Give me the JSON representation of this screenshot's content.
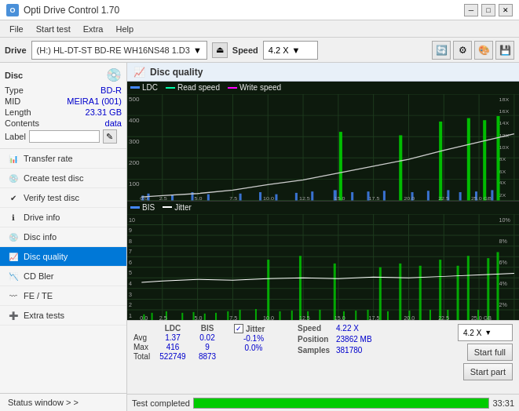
{
  "titlebar": {
    "title": "Opti Drive Control 1.70",
    "icon": "O"
  },
  "menubar": {
    "items": [
      "File",
      "Start test",
      "Extra",
      "Help"
    ]
  },
  "drivebar": {
    "drive_label": "Drive",
    "drive_value": "(H:)  HL-DT-ST BD-RE  WH16NS48 1.D3",
    "speed_label": "Speed",
    "speed_value": "4.2 X"
  },
  "disc": {
    "title": "Disc",
    "type_label": "Type",
    "type_value": "BD-R",
    "mid_label": "MID",
    "mid_value": "MEIRA1 (001)",
    "length_label": "Length",
    "length_value": "23.31 GB",
    "contents_label": "Contents",
    "contents_value": "data",
    "label_label": "Label",
    "label_value": ""
  },
  "nav": {
    "items": [
      {
        "label": "Transfer rate",
        "icon": "📊"
      },
      {
        "label": "Create test disc",
        "icon": "💿"
      },
      {
        "label": "Verify test disc",
        "icon": "✔"
      },
      {
        "label": "Drive info",
        "icon": "ℹ"
      },
      {
        "label": "Disc info",
        "icon": "💿"
      },
      {
        "label": "Disc quality",
        "icon": "📈",
        "active": true
      },
      {
        "label": "CD Bler",
        "icon": "📉"
      },
      {
        "label": "FE / TE",
        "icon": "〰"
      },
      {
        "label": "Extra tests",
        "icon": "➕"
      }
    ],
    "status_window": "Status window > >"
  },
  "chart": {
    "title": "Disc quality",
    "legend1": {
      "ldc": "LDC",
      "read": "Read speed",
      "write": "Write speed"
    },
    "legend2": {
      "bis": "BIS",
      "jitter": "Jitter"
    },
    "top_y_max": "500",
    "top_y_labels": [
      "500",
      "400",
      "300",
      "200",
      "100"
    ],
    "top_y_right": [
      "18X",
      "16X",
      "14X",
      "12X",
      "10X",
      "8X",
      "6X",
      "4X",
      "2X"
    ],
    "x_labels": [
      "0.0",
      "2.5",
      "5.0",
      "7.5",
      "10.0",
      "12.5",
      "15.0",
      "17.5",
      "20.0",
      "22.5",
      "25.0 GB"
    ],
    "bottom_y_left": [
      "10",
      "9",
      "8",
      "7",
      "6",
      "5",
      "4",
      "3",
      "2",
      "1"
    ],
    "bottom_y_right": [
      "10%",
      "8%",
      "6%",
      "4%",
      "2%"
    ]
  },
  "stats": {
    "col_ldc": "LDC",
    "col_bis": "BIS",
    "col_jitter": "Jitter",
    "jitter_checked": true,
    "avg_ldc": "1.37",
    "avg_bis": "0.02",
    "avg_jitter": "-0.1%",
    "max_ldc": "416",
    "max_bis": "9",
    "max_jitter": "0.0%",
    "total_ldc": "522749",
    "total_bis": "8873",
    "speed_label": "Speed",
    "speed_value": "4.22 X",
    "position_label": "Position",
    "position_value": "23862 MB",
    "samples_label": "Samples",
    "samples_value": "381780",
    "speed_select": "4.2 X",
    "start_full": "Start full",
    "start_part": "Start part"
  },
  "statusbar": {
    "text": "Test completed",
    "progress": 100,
    "time": "33:31"
  }
}
